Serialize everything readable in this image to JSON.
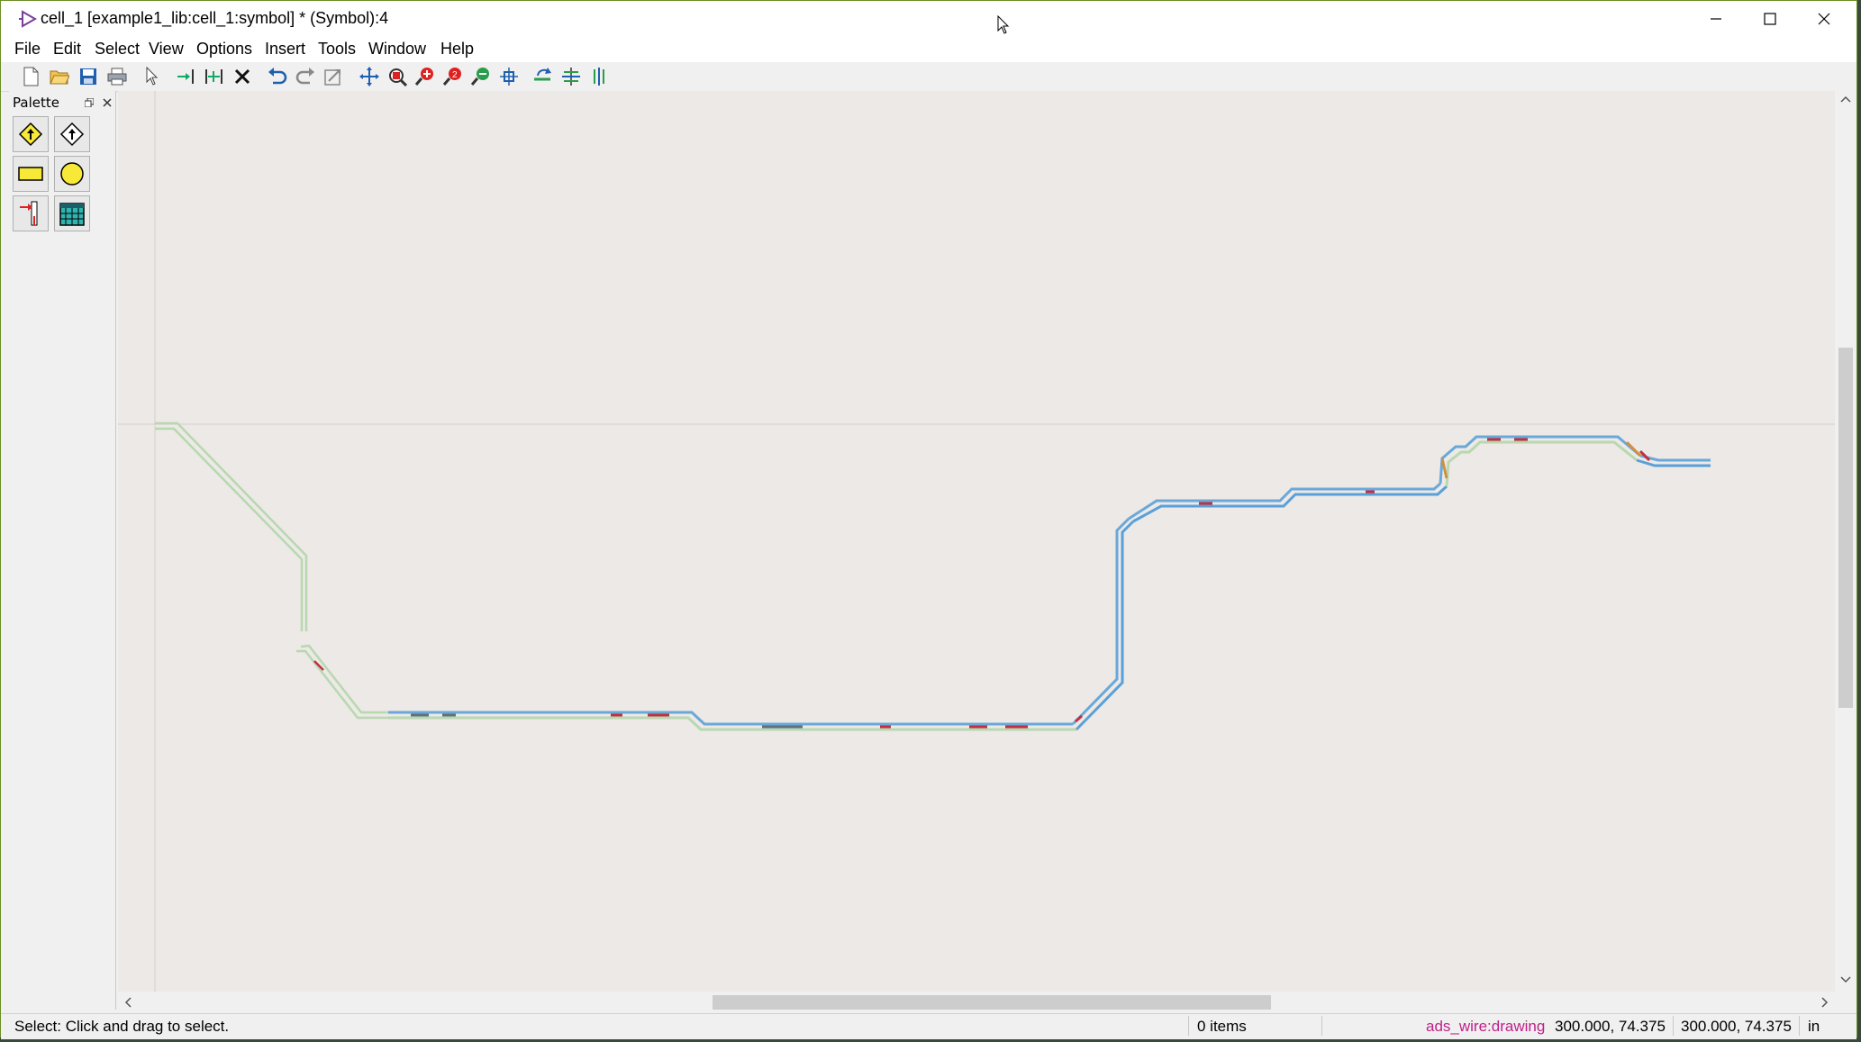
{
  "window": {
    "title": "cell_1 [example1_lib:cell_1:symbol] * (Symbol):4"
  },
  "menu": [
    "File",
    "Edit",
    "Select",
    "View",
    "Options",
    "Insert",
    "Tools",
    "Window",
    "Help"
  ],
  "toolbar_icons": [
    "new-file-icon",
    "open-folder-icon",
    "save-icon",
    "print-icon",
    "select-arrow-icon",
    "insert-pin-icon",
    "insert-pins-icon",
    "delete-icon",
    "undo-icon",
    "redo-icon",
    "repeat-icon",
    "move-icon",
    "zoom-area-icon",
    "zoom-in-icon",
    "zoom-out-icon",
    "zoom-previous-icon",
    "pan-icon",
    "rotate-icon",
    "mirror-x-icon",
    "mirror-y-icon"
  ],
  "palette": {
    "title": "Palette",
    "items": [
      "pin-arrow-filled-icon",
      "pin-arrow-outline-icon",
      "rectangle-icon",
      "circle-icon",
      "symbol-pin-icon",
      "calendar-grid-icon"
    ]
  },
  "status": {
    "message": "Select: Click and drag to select.",
    "items": "0 items",
    "layer": "ads_wire:drawing",
    "coord1": "300.000, 74.375",
    "coord2": "300.000, 74.375",
    "units": "in"
  },
  "colors": {
    "layer_text": "#c0208a",
    "canvas_bg": "#ece9e7",
    "trace_green": "#b8d8b0",
    "trace_blue": "#5aa0d8"
  }
}
